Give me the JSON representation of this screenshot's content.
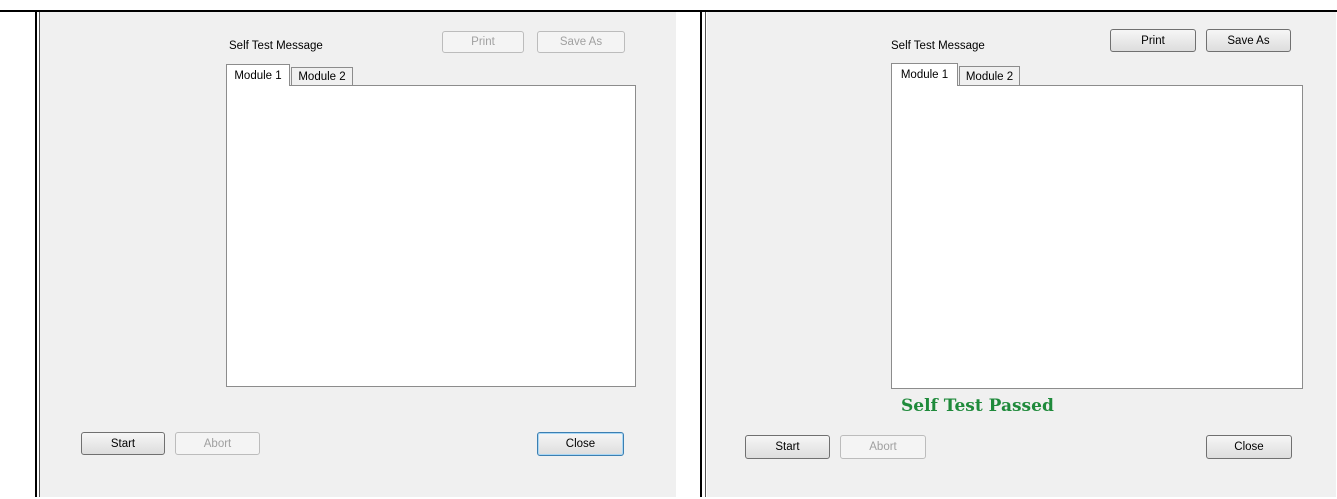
{
  "left_dialog": {
    "message_label": "Self Test Message",
    "print_label": "Print",
    "save_as_label": "Save As",
    "tabs": [
      {
        "label": "Module 1",
        "active": true
      },
      {
        "label": "Module 2",
        "active": false
      }
    ],
    "start_label": "Start",
    "abort_label": "Abort",
    "close_label": "Close",
    "print_enabled": false,
    "save_as_enabled": false,
    "abort_enabled": false
  },
  "right_dialog": {
    "message_label": "Self Test Message",
    "print_label": "Print",
    "save_as_label": "Save As",
    "tabs": [
      {
        "label": "Module 1",
        "active": true
      },
      {
        "label": "Module 2",
        "active": false
      }
    ],
    "status_text": "Self Test Passed",
    "start_label": "Start",
    "abort_label": "Abort",
    "close_label": "Close",
    "print_enabled": true,
    "save_as_enabled": true,
    "abort_enabled": false
  },
  "colors": {
    "status_passed": "#1f8a3b",
    "dialog_background": "#f0f0f0"
  }
}
